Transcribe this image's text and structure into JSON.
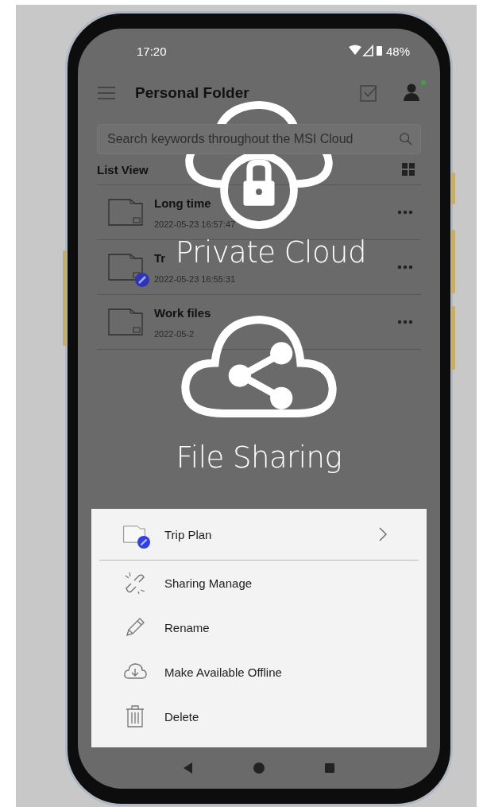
{
  "status_bar": {
    "time": "17:20",
    "battery": "48%"
  },
  "app_bar": {
    "title": "Personal Folder",
    "notification": true
  },
  "search": {
    "placeholder": "Search keywords throughout the MSI Cloud"
  },
  "list_header": {
    "label": "List View"
  },
  "folders": [
    {
      "name": "Long time",
      "date": "2022-05-23 16:57:47",
      "shared": false
    },
    {
      "name": "Tr",
      "date": "2022-05-23 16:55:31",
      "shared": true
    },
    {
      "name": "Work files",
      "date": "2022-05-2",
      "shared": false
    }
  ],
  "overlay": [
    {
      "kind": "lock",
      "caption": "Private Cloud"
    },
    {
      "kind": "share",
      "caption": "File Sharing"
    }
  ],
  "menu": {
    "title": "Trip Plan",
    "shared": true,
    "items": [
      {
        "kind": "share",
        "label": "Sharing Manage"
      },
      {
        "kind": "rename",
        "label": "Rename"
      },
      {
        "kind": "offline",
        "label": "Make Available Offline"
      },
      {
        "kind": "delete",
        "label": "Delete"
      }
    ]
  }
}
